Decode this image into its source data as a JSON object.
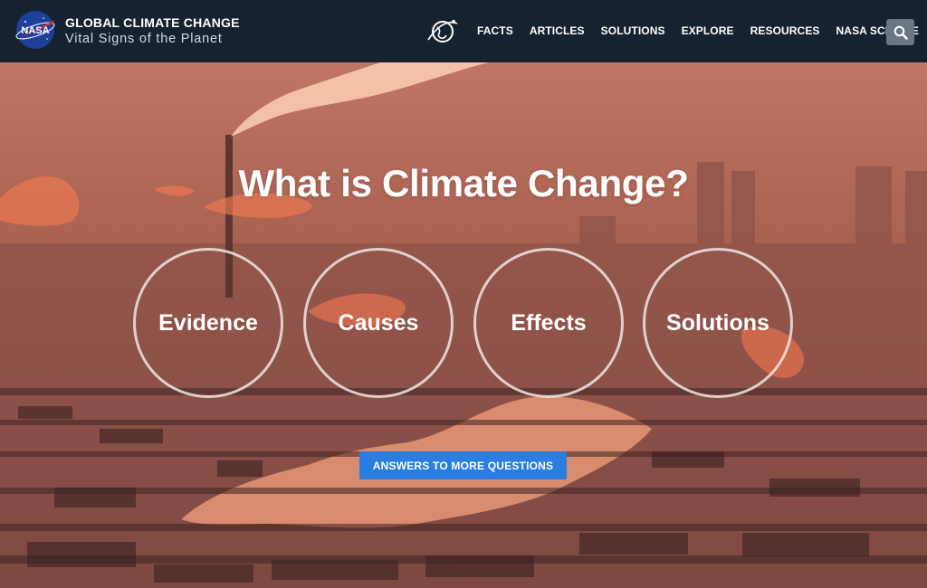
{
  "header": {
    "title": "GLOBAL CLIMATE CHANGE",
    "subtitle": "Vital Signs of the Planet",
    "logo_text": "NASA",
    "nav": [
      "FACTS",
      "ARTICLES",
      "SOLUTIONS",
      "EXPLORE",
      "RESOURCES",
      "NASA SCIENCE"
    ],
    "search_icon": "search-icon",
    "colors": {
      "bar": "#172230",
      "search_bg": "#6b7684"
    }
  },
  "hero": {
    "title": "What is Climate Change?",
    "circles": [
      "Evidence",
      "Causes",
      "Effects",
      "Solutions"
    ],
    "cta_label": "ANSWERS TO MORE QUESTIONS",
    "colors": {
      "cta": "#2a7de1",
      "tint": "#b86a5a"
    }
  }
}
